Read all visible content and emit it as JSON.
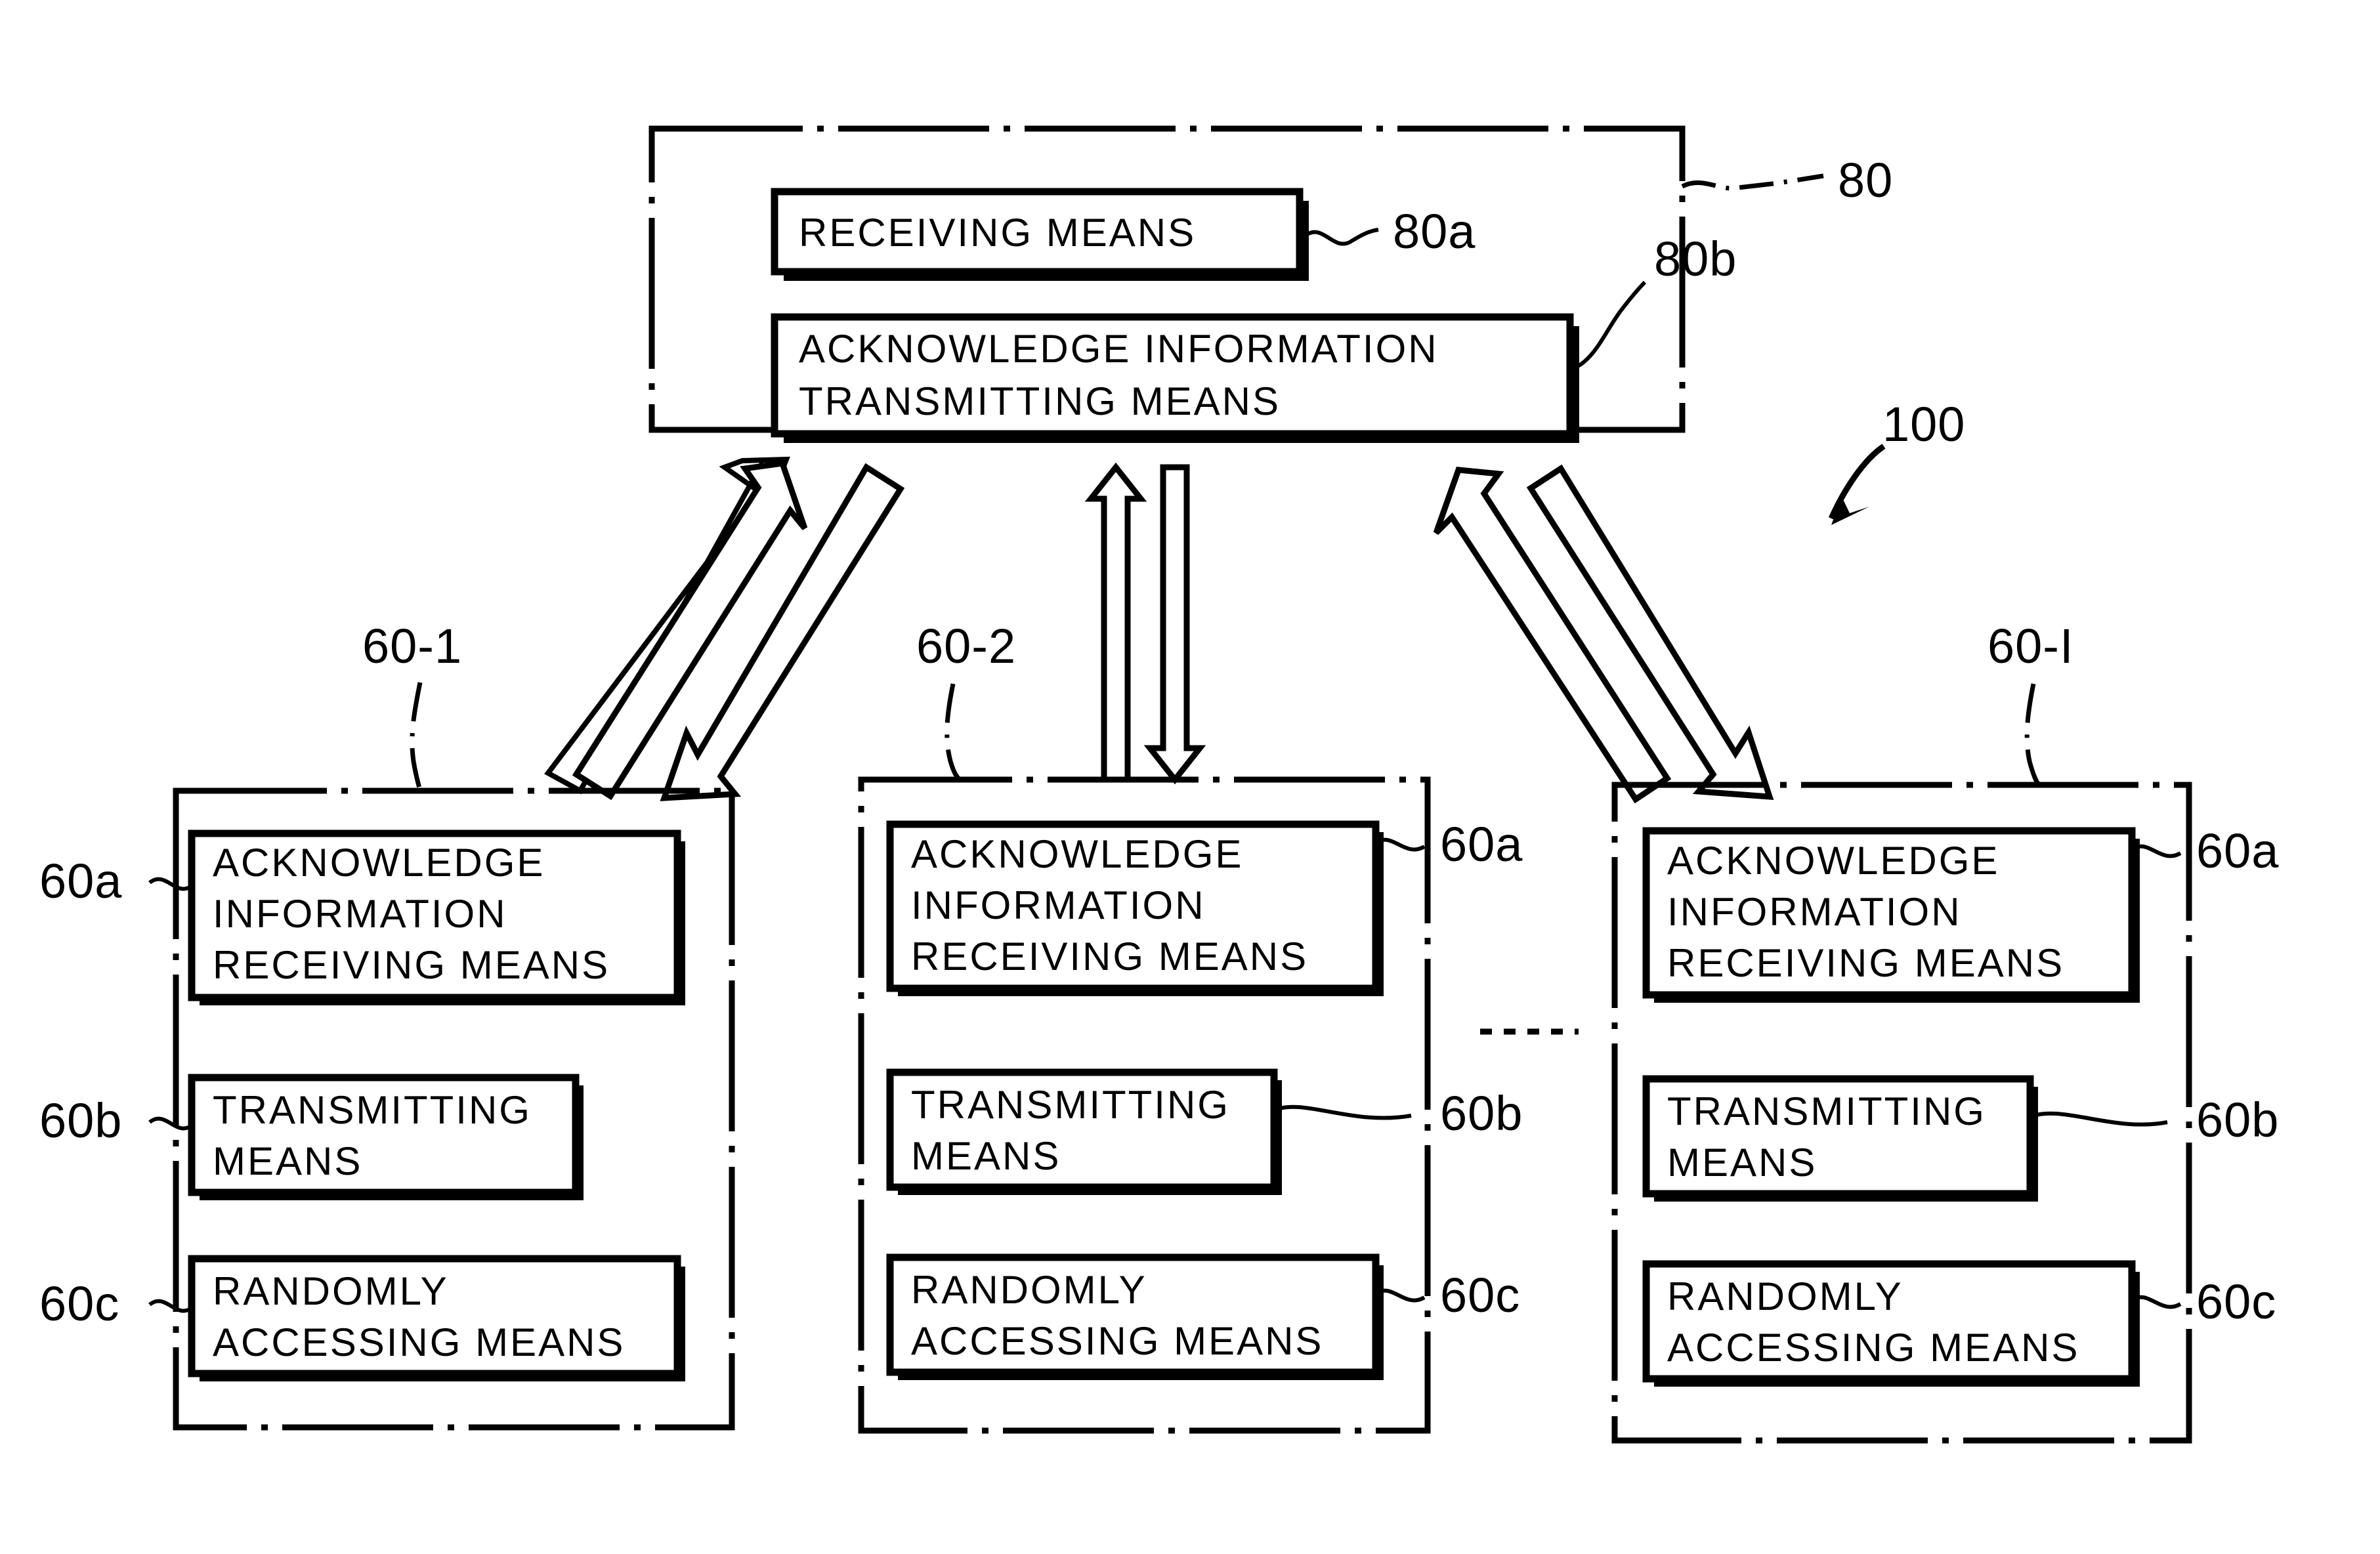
{
  "figure": {
    "type": "patent-block-diagram",
    "system_reference": "100",
    "background_color": "#ffffff",
    "line_color": "#000000"
  },
  "base_station": {
    "reference": "80",
    "border_style": "dash-dot",
    "blocks": [
      {
        "reference": "80a",
        "label": "RECEIVING  MEANS"
      },
      {
        "reference": "80b",
        "label_line1": "ACKNOWLEDGE INFORMATION",
        "label_line2": "TRANSMITTING  MEANS"
      }
    ]
  },
  "terminals": [
    {
      "reference": "60-1",
      "labels_side": "left",
      "blocks": [
        {
          "reference": "60a",
          "label_line1": "ACKNOWLEDGE",
          "label_line2": "INFORMATION",
          "label_line3": "RECEIVING  MEANS"
        },
        {
          "reference": "60b",
          "label_line1": "TRANSMITTING",
          "label_line2": "MEANS"
        },
        {
          "reference": "60c",
          "label_line1": "RANDOMLY",
          "label_line2": "ACCESSING  MEANS"
        }
      ]
    },
    {
      "reference": "60-2",
      "labels_side": "right",
      "blocks": [
        {
          "reference": "60a",
          "label_line1": "ACKNOWLEDGE",
          "label_line2": "INFORMATION",
          "label_line3": "RECEIVING  MEANS"
        },
        {
          "reference": "60b",
          "label_line1": "TRANSMITTING",
          "label_line2": "MEANS"
        },
        {
          "reference": "60c",
          "label_line1": "RANDOMLY",
          "label_line2": "ACCESSING  MEANS"
        }
      ]
    },
    {
      "reference": "60-I",
      "labels_side": "right",
      "blocks": [
        {
          "reference": "60a",
          "label_line1": "ACKNOWLEDGE",
          "label_line2": "INFORMATION",
          "label_line3": "RECEIVING  MEANS"
        },
        {
          "reference": "60b",
          "label_line1": "TRANSMITTING",
          "label_line2": "MEANS"
        },
        {
          "reference": "60c",
          "label_line1": "RANDOMLY",
          "label_line2": "ACCESSING  MEANS"
        }
      ]
    }
  ],
  "continuation": {
    "symbol": "- - - - -",
    "meaning": "additional terminals omitted"
  },
  "links": [
    {
      "from": "80",
      "to": "60-1",
      "style": "bidirectional-hollow-block-arrows"
    },
    {
      "from": "80",
      "to": "60-2",
      "style": "bidirectional-hollow-block-arrows"
    },
    {
      "from": "80",
      "to": "60-I",
      "style": "bidirectional-hollow-block-arrows"
    }
  ]
}
